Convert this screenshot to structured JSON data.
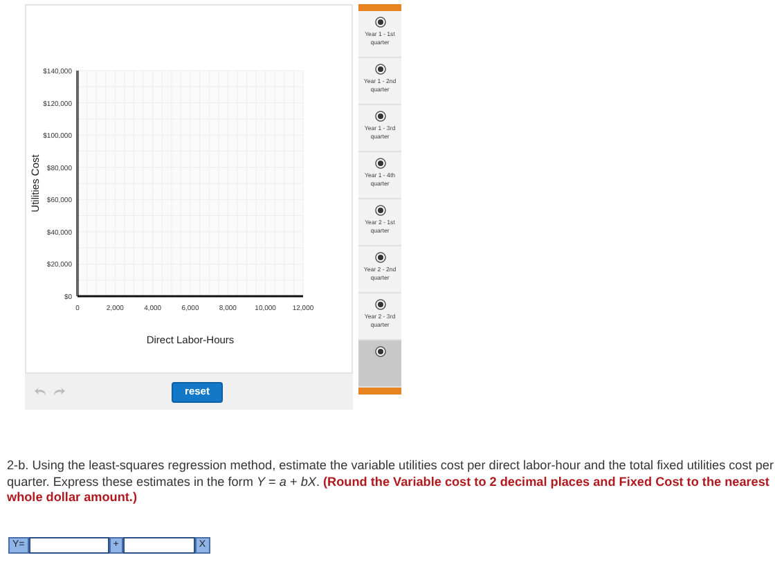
{
  "chart": {
    "chart_data": {
      "type": "scatter",
      "grid": true,
      "xlabel": "Direct Labor-Hours",
      "ylabel": "Utilities Cost",
      "xlim": [
        0,
        12000
      ],
      "ylim": [
        0,
        140000
      ],
      "xticks": [
        {
          "value": 0,
          "label": "0"
        },
        {
          "value": 2000,
          "label": "2,000"
        },
        {
          "value": 4000,
          "label": "4,000"
        },
        {
          "value": 6000,
          "label": "6,000"
        },
        {
          "value": 8000,
          "label": "8,000"
        },
        {
          "value": 10000,
          "label": "10,000"
        },
        {
          "value": 12000,
          "label": "12,000"
        }
      ],
      "yticks": [
        {
          "value": 0,
          "label": "$0"
        },
        {
          "value": 20000,
          "label": "$20,000"
        },
        {
          "value": 40000,
          "label": "$40,000"
        },
        {
          "value": 60000,
          "label": "$60,000"
        },
        {
          "value": 80000,
          "label": "$80,000"
        },
        {
          "value": 100000,
          "label": "$100,000"
        },
        {
          "value": 120000,
          "label": "$120,000"
        },
        {
          "value": 140000,
          "label": "$140,000"
        }
      ]
    }
  },
  "toolbar": {
    "reset_button": "reset"
  },
  "point_list": [
    {
      "label": "Year 1 - 1st quarter",
      "selected": false
    },
    {
      "label": "Year 1 - 2nd quarter",
      "selected": false
    },
    {
      "label": "Year 1 - 3rd quarter",
      "selected": false
    },
    {
      "label": "Year 1 - 4th quarter",
      "selected": false
    },
    {
      "label": "Year 2 - 1st quarter",
      "selected": false
    },
    {
      "label": "Year 2 - 2nd quarter",
      "selected": false
    },
    {
      "label": "Year 2 - 3rd quarter",
      "selected": false
    },
    {
      "selected": true
    }
  ],
  "question": "2-b. Using the least-squares regression method, estimate the variable utilities cost per direct labor-hour and the total fixed utilities cost per quarter. Express these estimates in the form *Y* = *a* + *bX*. **(Round the Variable cost to 2 decimal places and Fixed Cost to the nearest whole dollar amount.)**",
  "equation": {
    "prefix": "Y=",
    "operator": "+",
    "suffix": "X"
  }
}
